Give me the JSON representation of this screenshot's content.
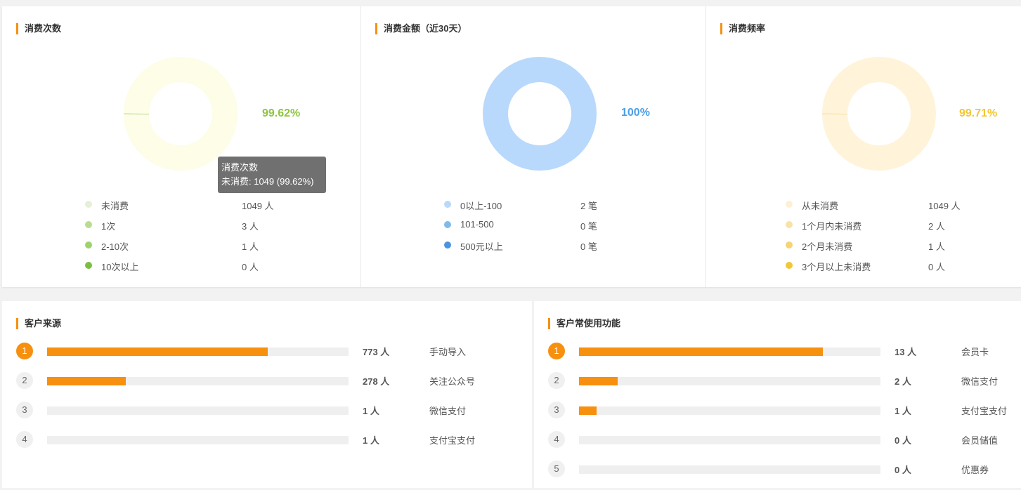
{
  "colors": {
    "accent": "#f7900f",
    "track": "#efefef"
  },
  "cards": [
    {
      "title": "消费次数",
      "percent": "99.62%",
      "percent_color": "#8cc63e",
      "donut_color": "#fdfde8",
      "donut_share": 0.9962,
      "minor_color": "#b8d88a",
      "legend": [
        {
          "label": "未消费",
          "value": "1049 人",
          "color": "#e6efd8"
        },
        {
          "label": "1次",
          "value": "3 人",
          "color": "#b8dc94"
        },
        {
          "label": "2-10次",
          "value": "1 人",
          "color": "#9fd16e"
        },
        {
          "label": "10次以上",
          "value": "0 人",
          "color": "#7abf3e"
        }
      ]
    },
    {
      "title": "消费金额（近30天）",
      "percent": "100%",
      "percent_color": "#4a9fe6",
      "donut_color": "#b8d9fb",
      "donut_share": 1.0,
      "minor_color": "#b8d9fb",
      "legend": [
        {
          "label": "0以上-100",
          "value": "2 笔",
          "color": "#b8d9fb"
        },
        {
          "label": "101-500",
          "value": "0 笔",
          "color": "#7fbaeb"
        },
        {
          "label": "500元以上",
          "value": "0 笔",
          "color": "#4a94e2"
        }
      ]
    },
    {
      "title": "消费频率",
      "percent": "99.71%",
      "percent_color": "#f2c637",
      "donut_color": "#fff3d9",
      "donut_share": 0.9971,
      "minor_color": "#f6dfa0",
      "legend": [
        {
          "label": "从未消费",
          "value": "1049 人",
          "color": "#fdf0d4"
        },
        {
          "label": "1个月内未消费",
          "value": "2 人",
          "color": "#f9e2a8"
        },
        {
          "label": "2个月未消费",
          "value": "1 人",
          "color": "#f6d474"
        },
        {
          "label": "3个月以上未消费",
          "value": "0 人",
          "color": "#f2c637"
        }
      ]
    }
  ],
  "tooltip": {
    "title": "消费次数",
    "text": "未消费: 1049 (99.62%)"
  },
  "source": {
    "title": "客户来源",
    "items": [
      {
        "rank": "1",
        "count": "773 人",
        "label": "手动导入",
        "share": 0.733
      },
      {
        "rank": "2",
        "count": "278 人",
        "label": "关注公众号",
        "share": 0.26
      },
      {
        "rank": "3",
        "count": "1 人",
        "label": "微信支付",
        "share": 0.0
      },
      {
        "rank": "4",
        "count": "1 人",
        "label": "支付宝支付",
        "share": 0.0
      }
    ]
  },
  "features": {
    "title": "客户常使用功能",
    "items": [
      {
        "rank": "1",
        "count": "13 人",
        "label": "会员卡",
        "share": 0.81
      },
      {
        "rank": "2",
        "count": "2 人",
        "label": "微信支付",
        "share": 0.128
      },
      {
        "rank": "3",
        "count": "1 人",
        "label": "支付宝支付",
        "share": 0.058
      },
      {
        "rank": "4",
        "count": "0 人",
        "label": "会员储值",
        "share": 0.0
      },
      {
        "rank": "5",
        "count": "0 人",
        "label": "优惠券",
        "share": 0.0
      }
    ]
  }
}
